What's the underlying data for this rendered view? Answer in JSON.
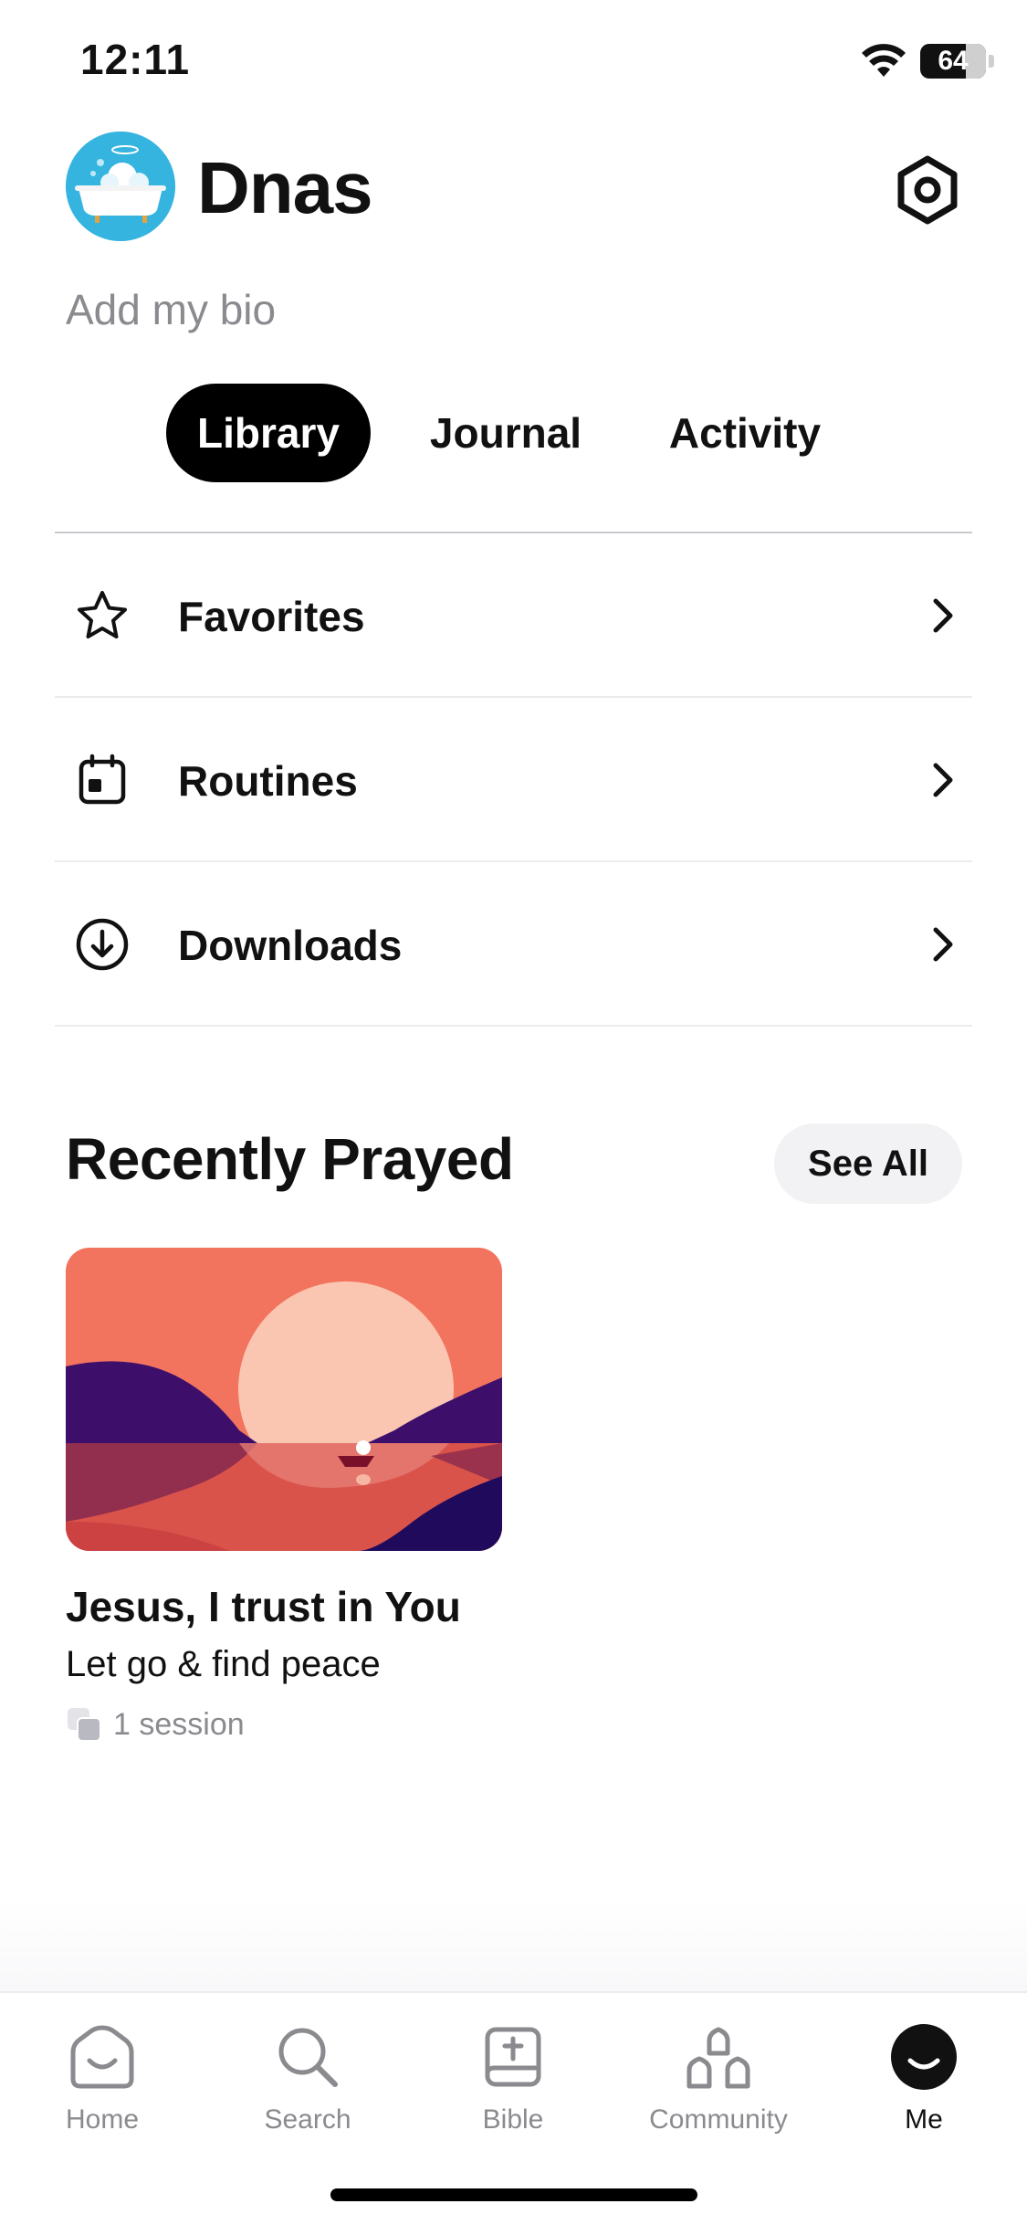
{
  "status_bar": {
    "time": "12:11",
    "battery": "64"
  },
  "profile": {
    "name": "Dnas",
    "bio_placeholder": "Add my bio"
  },
  "tabs": [
    {
      "label": "Library",
      "active": true
    },
    {
      "label": "Journal",
      "active": false
    },
    {
      "label": "Activity",
      "active": false
    }
  ],
  "library_items": [
    {
      "label": "Favorites",
      "icon": "star-icon"
    },
    {
      "label": "Routines",
      "icon": "calendar-icon"
    },
    {
      "label": "Downloads",
      "icon": "download-icon"
    }
  ],
  "recently_prayed": {
    "title": "Recently Prayed",
    "see_all_label": "See All",
    "items": [
      {
        "title": "Jesus, I trust in You",
        "subtitle": "Let go & find peace",
        "meta": "1 session"
      }
    ]
  },
  "bottom_nav": [
    {
      "label": "Home",
      "icon": "home-icon",
      "active": false
    },
    {
      "label": "Search",
      "icon": "search-icon",
      "active": false
    },
    {
      "label": "Bible",
      "icon": "bible-icon",
      "active": false
    },
    {
      "label": "Community",
      "icon": "community-icon",
      "active": false
    },
    {
      "label": "Me",
      "icon": "me-icon",
      "active": true
    }
  ],
  "colors": {
    "avatar_bg": "#35b4e0",
    "active_tab_bg": "#000000",
    "secondary_text": "#8a8a8f",
    "pill_bg": "#f2f2f4",
    "artwork_sky": "#f2735e",
    "artwork_sun": "#fbc6b1",
    "artwork_hills": "#3d0f6b"
  }
}
